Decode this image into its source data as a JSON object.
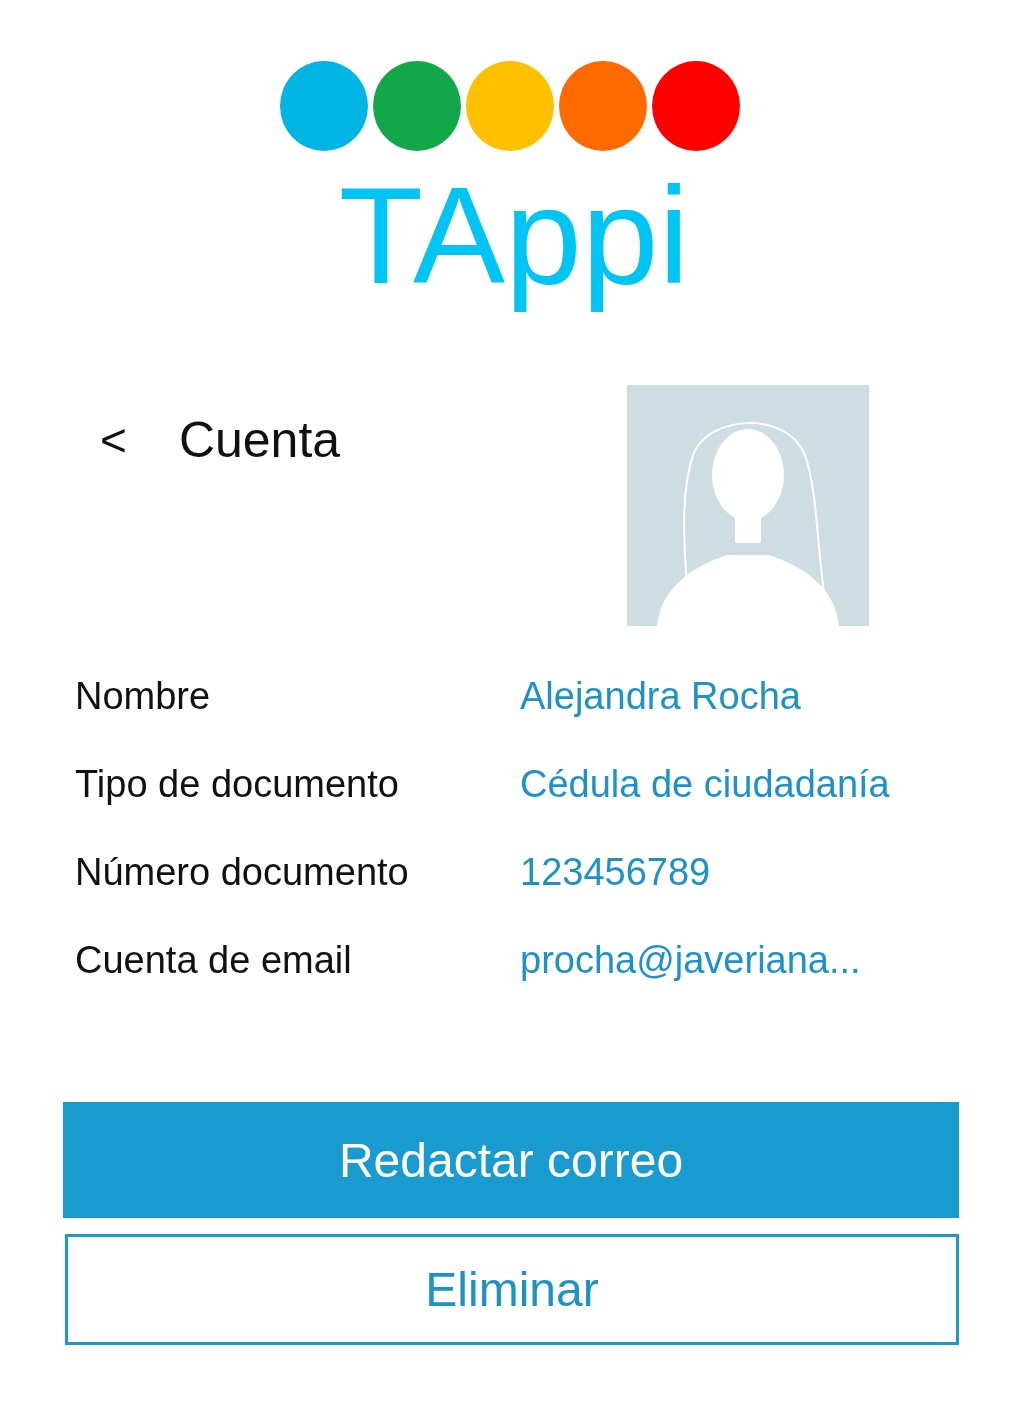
{
  "logo": {
    "dots": [
      {
        "color": "#00b4e4"
      },
      {
        "color": "#12a84a"
      },
      {
        "color": "#ffc000"
      },
      {
        "color": "#ff6a00"
      },
      {
        "color": "#fe0000"
      }
    ],
    "wordmark": "TAppi"
  },
  "header": {
    "back": "<",
    "title": "Cuenta"
  },
  "fields": [
    {
      "label": "Nombre",
      "value": "Alejandra Rocha"
    },
    {
      "label": "Tipo de documento",
      "value": "Cédula de ciudadanía"
    },
    {
      "label": "Número  documento",
      "value": "123456789"
    },
    {
      "label": "Cuenta de email",
      "value": "procha@javeriana..."
    }
  ],
  "buttons": [
    {
      "label": "Redactar correo",
      "kind": "primary"
    },
    {
      "label": "Eliminar",
      "kind": "outline"
    }
  ]
}
